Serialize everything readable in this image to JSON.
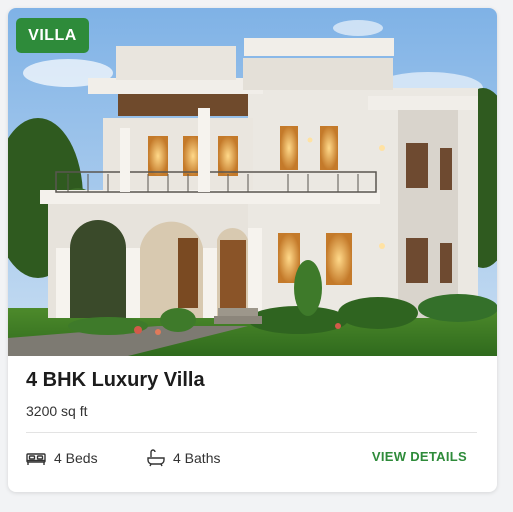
{
  "card": {
    "badge": "VILLA",
    "title": "4 BHK Luxury Villa",
    "area": "3200 sq ft",
    "features": {
      "beds": "4 Beds",
      "baths": "4 Baths"
    },
    "cta": "VIEW DETAILS",
    "image_description": "villa-photo",
    "icons": {
      "beds": "bed-icon",
      "baths": "bathtub-icon"
    }
  },
  "colors": {
    "accent": "#2e8b3a",
    "badge_bg": "#2e8b3a",
    "title_text": "#1c1c1c",
    "body_text": "#333333"
  }
}
